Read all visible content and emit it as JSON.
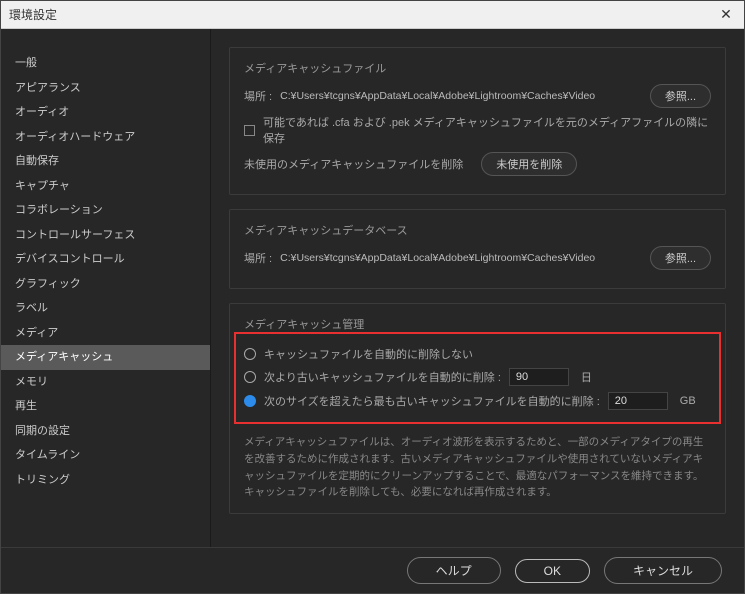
{
  "window": {
    "title": "環境設定"
  },
  "sidebar": {
    "items": [
      {
        "label": "一般"
      },
      {
        "label": "アピアランス"
      },
      {
        "label": "オーディオ"
      },
      {
        "label": "オーディオハードウェア"
      },
      {
        "label": "自動保存"
      },
      {
        "label": "キャプチャ"
      },
      {
        "label": "コラボレーション"
      },
      {
        "label": "コントロールサーフェス"
      },
      {
        "label": "デバイスコントロール"
      },
      {
        "label": "グラフィック"
      },
      {
        "label": "ラベル"
      },
      {
        "label": "メディア"
      },
      {
        "label": "メディアキャッシュ"
      },
      {
        "label": "メモリ"
      },
      {
        "label": "再生"
      },
      {
        "label": "同期の設定"
      },
      {
        "label": "タイムライン"
      },
      {
        "label": "トリミング"
      }
    ],
    "selected_index": 12
  },
  "section_cache_files": {
    "title": "メディアキャッシュファイル",
    "location_label": "場所 :",
    "location_path": "C:¥Users¥tcgns¥AppData¥Local¥Adobe¥Lightroom¥Caches¥Video",
    "browse": "参照...",
    "checkbox_label": "可能であれば .cfa および .pek メディアキャッシュファイルを元のメディアファイルの隣に保存",
    "cleanup_label": "未使用のメディアキャッシュファイルを削除",
    "cleanup_button": "未使用を削除"
  },
  "section_cache_db": {
    "title": "メディアキャッシュデータベース",
    "location_label": "場所 :",
    "location_path": "C:¥Users¥tcgns¥AppData¥Local¥Adobe¥Lightroom¥Caches¥Video",
    "browse": "参照..."
  },
  "section_cache_mgmt": {
    "title": "メディアキャッシュ管理",
    "radio_none": "キャッシュファイルを自動的に削除しない",
    "radio_days": "次より古いキャッシュファイルを自動的に削除 :",
    "days_value": "90",
    "days_unit": "日",
    "radio_size": "次のサイズを超えたら最も古いキャッシュファイルを自動的に削除 :",
    "size_value": "20",
    "size_unit": "GB",
    "selected_radio": 2,
    "description": "メディアキャッシュファイルは、オーディオ波形を表示するためと、一部のメディアタイプの再生を改善するために作成されます。古いメディアキャッシュファイルや使用されていないメディアキャッシュファイルを定期的にクリーンアップすることで、最適なパフォーマンスを維持できます。キャッシュファイルを削除しても、必要になれば再作成されます。"
  },
  "footer": {
    "help": "ヘルプ",
    "ok": "OK",
    "cancel": "キャンセル"
  }
}
